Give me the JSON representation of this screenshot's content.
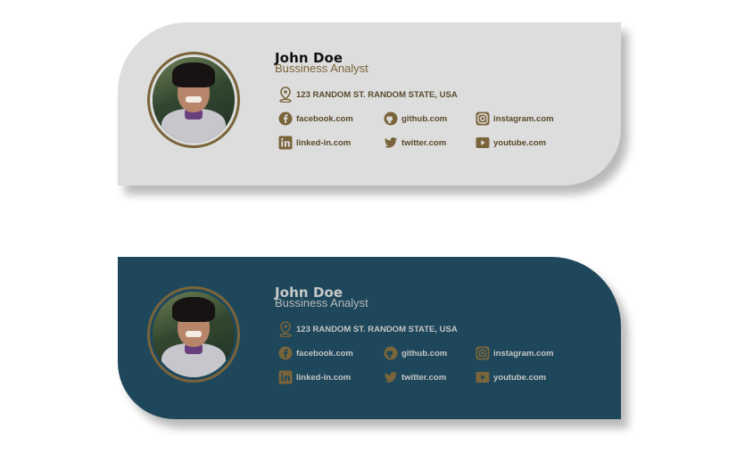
{
  "colors": {
    "accent": "#7a643a",
    "light_card_bg": "#dddddd",
    "dark_card_bg": "#1e475b"
  },
  "cards": [
    {
      "theme": "light",
      "name": "John Doe",
      "role": "Bussiness Analyst",
      "address": "123 RANDOM ST. RANDOM STATE, USA",
      "links": {
        "facebook": "facebook.com",
        "github": "github.com",
        "instagram": "instagram.com",
        "linkedin": "linked-in.com",
        "twitter": "twitter.com",
        "youtube": "youtube.com"
      }
    },
    {
      "theme": "dark",
      "name": "John Doe",
      "role": "Bussiness Analyst",
      "address": "123 RANDOM ST. RANDOM STATE, USA",
      "links": {
        "facebook": "facebook.com",
        "github": "github.com",
        "instagram": "instagram.com",
        "linkedin": "linked-in.com",
        "twitter": "twitter.com",
        "youtube": "youtube.com"
      }
    }
  ],
  "icons": [
    "location-icon",
    "facebook-icon",
    "github-icon",
    "instagram-icon",
    "linkedin-icon",
    "twitter-icon",
    "youtube-icon"
  ]
}
